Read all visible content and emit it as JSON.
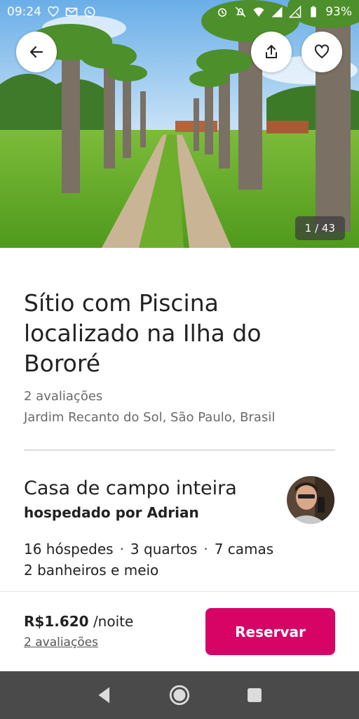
{
  "status_bar": {
    "time": "09:24",
    "battery": "93%",
    "icons_left": [
      "heart-outline-icon",
      "gmail-icon",
      "whatsapp-icon"
    ],
    "icons_right": [
      "alarm-icon",
      "mute-icon",
      "wifi-icon",
      "signal-icon",
      "no-sim-icon",
      "battery-icon"
    ]
  },
  "photo": {
    "counter": "1 / 43"
  },
  "listing": {
    "title": "Sítio com Piscina localizado na Ilha do Bororé",
    "reviews": "2 avaliações",
    "location": "Jardim Recanto do Sol, São Paulo, Brasil"
  },
  "host_section": {
    "type": "Casa de campo inteira",
    "host": "hospedado por Adrian",
    "guests": "16 hóspedes",
    "bedrooms": "3 quartos",
    "beds": "7 camas",
    "separator": "·",
    "bathrooms": "2 banheiros e meio"
  },
  "booking": {
    "price": "R$1.620",
    "unit": "/noite",
    "reviews_link": "2 avaliações",
    "reserve_label": "Reservar"
  },
  "colors": {
    "accent": "#d70466",
    "nav_bar": "#4a4a4a",
    "muted_text": "#6a6a6a"
  }
}
